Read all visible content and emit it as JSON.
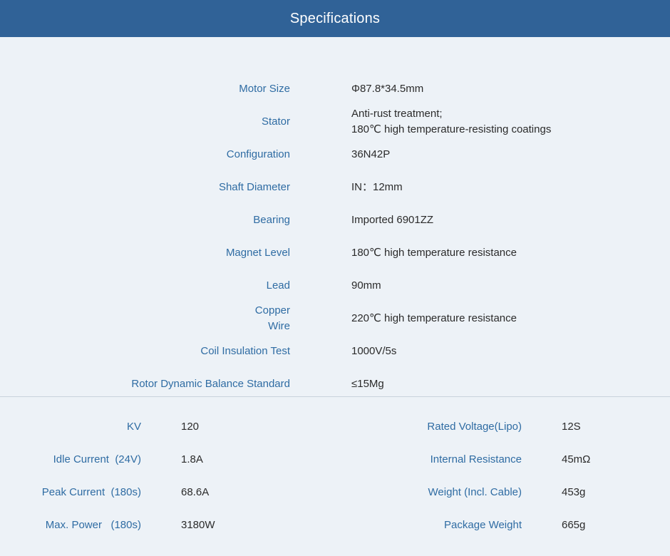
{
  "header": {
    "title": "Specifications"
  },
  "specs": [
    {
      "label": "Motor Size",
      "value": "Φ87.8*34.5mm"
    },
    {
      "label": "Stator",
      "value_line1": "Anti-rust treatment;",
      "value_line2": "180℃ high temperature-resisting coatings"
    },
    {
      "label": "Configuration",
      "value": "36N42P"
    },
    {
      "label": "Shaft Diameter",
      "value": "IN：12mm"
    },
    {
      "label": "Bearing",
      "value": "Imported 6901ZZ"
    },
    {
      "label": "Magnet Level",
      "value": "180℃ high temperature resistance"
    },
    {
      "label": "Lead",
      "value": "90mm"
    },
    {
      "label_line1": "Copper",
      "label_line2": "Wire",
      "value": "220℃ high temperature resistance"
    },
    {
      "label": "Coil Insulation Test",
      "value": "1000V/5s"
    },
    {
      "label": "Rotor Dynamic Balance Standard",
      "value": "≤15Mg"
    }
  ],
  "params": [
    {
      "left_label": "KV",
      "left_value": "120",
      "right_label": "Rated Voltage(Lipo)",
      "right_value": "12S"
    },
    {
      "left_label": "Idle Current  (24V)",
      "left_value": "1.8A",
      "right_label": "Internal Resistance",
      "right_value": "45mΩ"
    },
    {
      "left_label": "Peak Current  (180s)",
      "left_value": "68.6A",
      "right_label": "Weight (Incl. Cable)",
      "right_value": "453g"
    },
    {
      "left_label": "Max. Power   (180s)",
      "left_value": "3180W",
      "right_label": "Package Weight",
      "right_value": "665g"
    }
  ]
}
